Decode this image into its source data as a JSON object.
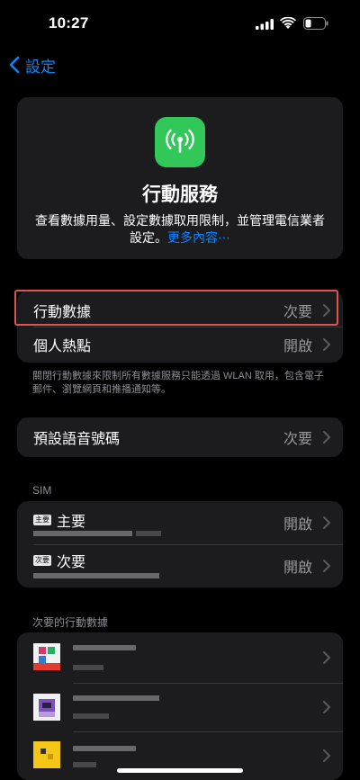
{
  "status_bar": {
    "time": "10:27"
  },
  "nav": {
    "back_label": "設定"
  },
  "hero": {
    "title": "行動服務",
    "description": "查看數據用量、設定數據取用限制，並管理電信業者設定。",
    "link_text": "更多內容⋯"
  },
  "group1": {
    "rows": [
      {
        "label": "行動數據",
        "value": "次要"
      },
      {
        "label": "個人熱點",
        "value": "開啟"
      }
    ],
    "footnote": "關閉行動數據來限制所有數據服務只能透過 WLAN 取用，包含電子郵件、瀏覽網頁和推播通知等。"
  },
  "group2": {
    "rows": [
      {
        "label": "預設語音號碼",
        "value": "次要"
      }
    ]
  },
  "sim_section": {
    "header": "SIM",
    "lines": [
      {
        "tag": "主要",
        "name": "主要",
        "value": "開啟"
      },
      {
        "tag": "次要",
        "name": "次要",
        "value": "開啟"
      }
    ]
  },
  "apps_section": {
    "header": "次要的行動數據"
  },
  "colors": {
    "accent": "#0a84ff",
    "icon_green": "#32c759",
    "highlight": "#e0554b",
    "card": "#1c1c1e"
  },
  "icons": [
    "signal-icon",
    "wifi-icon",
    "battery-icon",
    "chevron-left-icon",
    "antenna-icon",
    "chevron-right-icon"
  ]
}
